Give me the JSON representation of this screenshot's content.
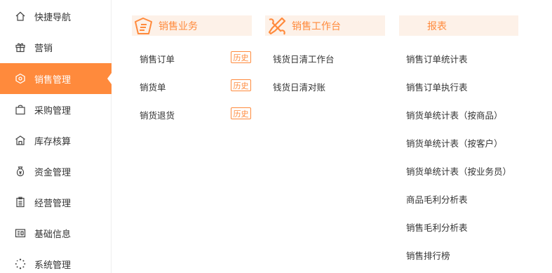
{
  "sidebar": {
    "items": [
      {
        "label": "快捷导航",
        "icon": "home-icon"
      },
      {
        "label": "营销",
        "icon": "gift-icon"
      },
      {
        "label": "销售管理",
        "icon": "sales-icon",
        "active": true
      },
      {
        "label": "采购管理",
        "icon": "shopping-bag-icon"
      },
      {
        "label": "库存核算",
        "icon": "warehouse-icon"
      },
      {
        "label": "资金管理",
        "icon": "money-bag-icon"
      },
      {
        "label": "经营管理",
        "icon": "clipboard-icon"
      },
      {
        "label": "基础信息",
        "icon": "id-card-icon"
      },
      {
        "label": "系统管理",
        "icon": "settings-spinner-icon"
      }
    ]
  },
  "columns": {
    "sales_business": {
      "title": "销售业务",
      "items": [
        {
          "label": "销售订单",
          "tag": "历史"
        },
        {
          "label": "销货单",
          "tag": "历史"
        },
        {
          "label": "销货退货",
          "tag": "历史"
        }
      ]
    },
    "sales_workbench": {
      "title": "销售工作台",
      "items": [
        {
          "label": "钱货日清工作台"
        },
        {
          "label": "钱货日清对账"
        }
      ]
    },
    "reports": {
      "title": "报表",
      "items": [
        {
          "label": "销售订单统计表"
        },
        {
          "label": "销售订单执行表"
        },
        {
          "label": "销货单统计表（按商品）"
        },
        {
          "label": "销货单统计表（按客户）"
        },
        {
          "label": "销货单统计表（按业务员）"
        },
        {
          "label": "商品毛利分析表"
        },
        {
          "label": "销售毛利分析表"
        },
        {
          "label": "销售排行榜"
        }
      ]
    }
  },
  "colors": {
    "accent": "#ff8a3c",
    "header_bg": "#fdf1e8"
  }
}
